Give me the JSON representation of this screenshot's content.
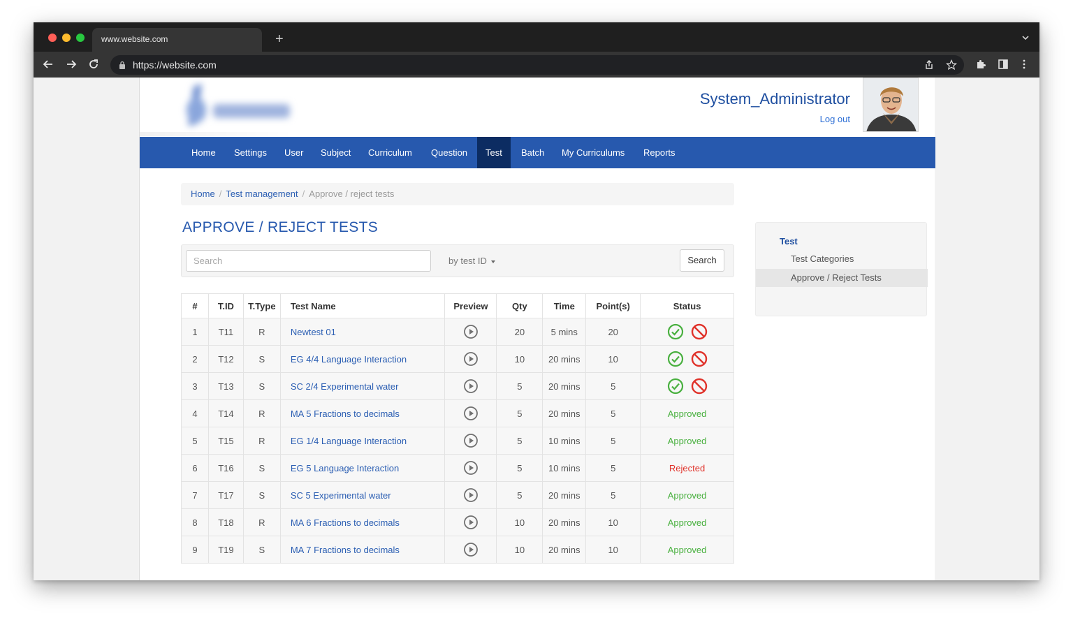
{
  "browser": {
    "tab_title": "www.website.com",
    "new_tab": "+",
    "url": "https://website.com"
  },
  "header": {
    "username": "System_Administrator",
    "logout": "Log out"
  },
  "nav": {
    "items": [
      "Home",
      "Settings",
      "User",
      "Subject",
      "Curriculum",
      "Question",
      "Test",
      "Batch",
      "My Curriculums",
      "Reports"
    ],
    "active": "Test"
  },
  "breadcrumb": {
    "items": [
      "Home",
      "Test management",
      "Approve / reject tests"
    ],
    "separator": "/"
  },
  "page": {
    "title": "APPROVE / REJECT TESTS"
  },
  "search": {
    "placeholder": "Search",
    "value": "",
    "filter_label": "by test ID",
    "button_label": "Search"
  },
  "table": {
    "columns": [
      "#",
      "T.ID",
      "T.Type",
      "Test Name",
      "Preview",
      "Qty",
      "Time",
      "Point(s)",
      "Status"
    ],
    "rows": [
      {
        "num": "1",
        "tid": "T11",
        "type": "R",
        "name": "Newtest 01",
        "qty": "20",
        "time": "5 mins",
        "points": "20",
        "status": "pending"
      },
      {
        "num": "2",
        "tid": "T12",
        "type": "S",
        "name": "EG 4/4 Language Interaction",
        "qty": "10",
        "time": "20 mins",
        "points": "10",
        "status": "pending"
      },
      {
        "num": "3",
        "tid": "T13",
        "type": "S",
        "name": "SC 2/4 Experimental water",
        "qty": "5",
        "time": "20 mins",
        "points": "5",
        "status": "pending"
      },
      {
        "num": "4",
        "tid": "T14",
        "type": "R",
        "name": "MA 5 Fractions to decimals",
        "qty": "5",
        "time": "20 mins",
        "points": "5",
        "status": "Approved"
      },
      {
        "num": "5",
        "tid": "T15",
        "type": "R",
        "name": "EG 1/4 Language Interaction",
        "qty": "5",
        "time": "10 mins",
        "points": "5",
        "status": "Approved"
      },
      {
        "num": "6",
        "tid": "T16",
        "type": "S",
        "name": "EG 5 Language Interaction",
        "qty": "5",
        "time": "10 mins",
        "points": "5",
        "status": "Rejected"
      },
      {
        "num": "7",
        "tid": "T17",
        "type": "S",
        "name": "SC 5 Experimental water",
        "qty": "5",
        "time": "20 mins",
        "points": "5",
        "status": "Approved"
      },
      {
        "num": "8",
        "tid": "T18",
        "type": "R",
        "name": "MA 6 Fractions to decimals",
        "qty": "10",
        "time": "20 mins",
        "points": "10",
        "status": "Approved"
      },
      {
        "num": "9",
        "tid": "T19",
        "type": "S",
        "name": "MA 7 Fractions to decimals",
        "qty": "10",
        "time": "20 mins",
        "points": "10",
        "status": "Approved"
      }
    ]
  },
  "sidebar": {
    "title": "Test",
    "items": [
      "Test Categories",
      "Approve / Reject Tests"
    ],
    "active": "Approve / Reject Tests"
  },
  "colors": {
    "nav_bg": "#2759ae",
    "nav_active": "#0c2c62",
    "title": "#2759ae",
    "link": "#2c5fb3",
    "approved": "#49b03f",
    "rejected": "#e0322a"
  },
  "icons": {
    "preview": "play-circle-icon",
    "approve": "check-circle-icon",
    "reject": "ban-icon"
  }
}
